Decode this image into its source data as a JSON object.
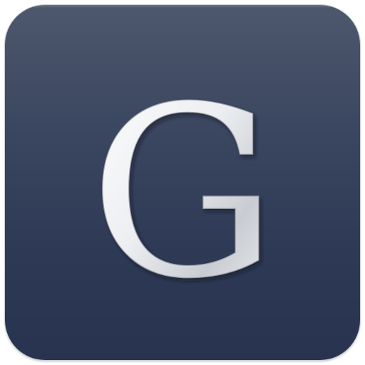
{
  "icon": {
    "letter": "G",
    "background_top": "#4d586d",
    "background_bottom": "#28344f",
    "glyph_light": "#ffffff",
    "glyph_mid": "#d9dbe0",
    "glyph_shadow": "#8a8f99"
  }
}
